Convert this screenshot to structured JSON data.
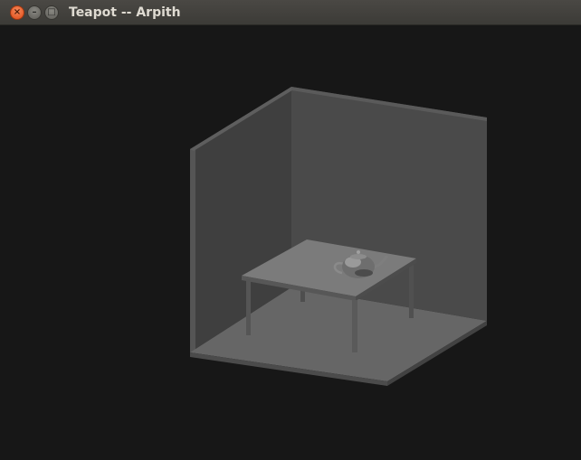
{
  "window": {
    "title": "Teapot -- Arpith",
    "controls": {
      "close": "×",
      "minimize": "–",
      "maximize": "□"
    }
  },
  "scene": {
    "background_color": "#171717",
    "objects": [
      "room-floor",
      "back-wall",
      "left-wall",
      "table",
      "teapot"
    ]
  }
}
